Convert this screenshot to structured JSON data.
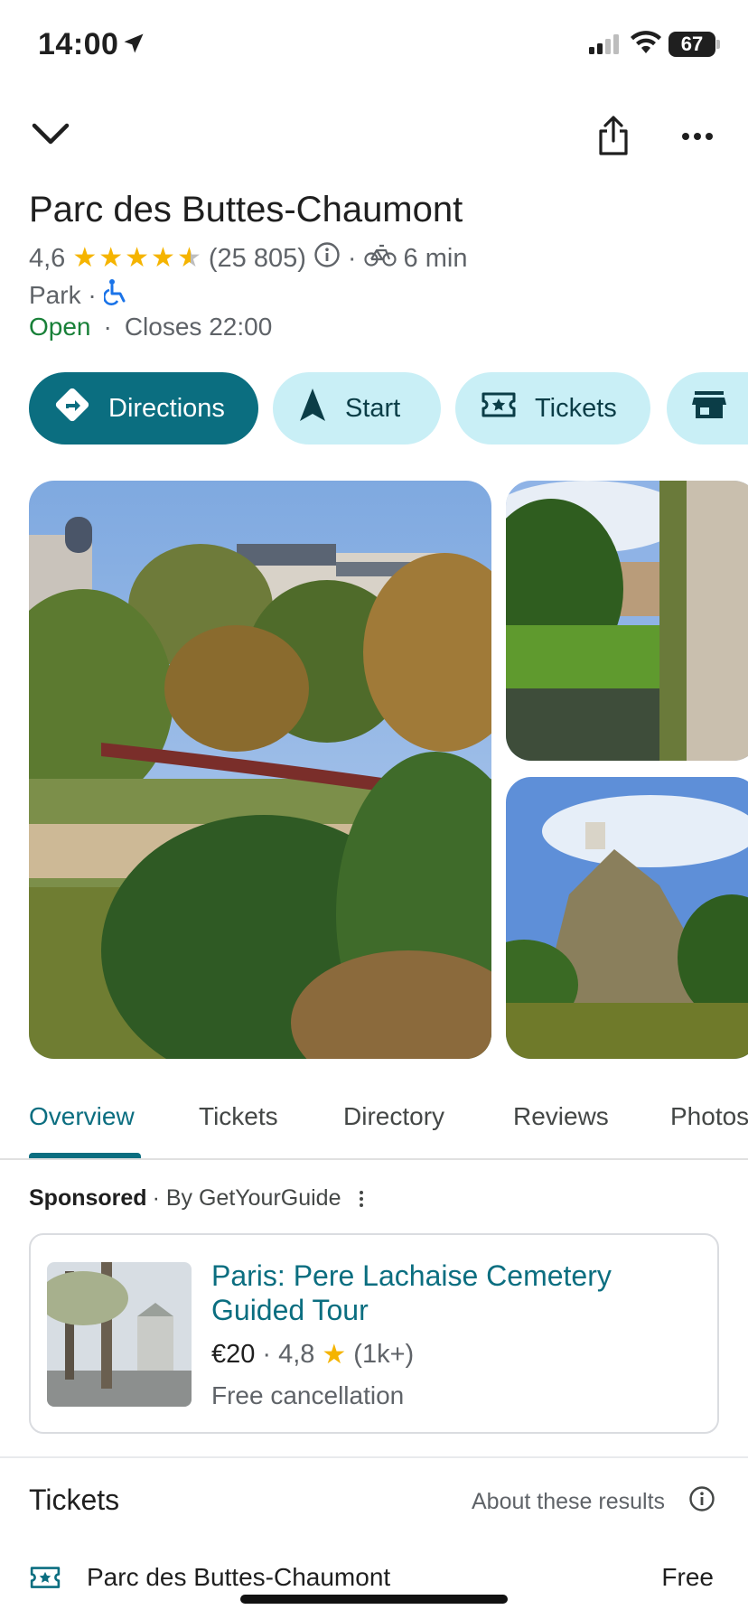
{
  "status_bar": {
    "time": "14:00",
    "battery": "67"
  },
  "place": {
    "name": "Parc des Buttes-Chaumont",
    "rating": "4,6",
    "stars": 4.5,
    "review_count": "(25 805)",
    "separator": "·",
    "travel_time": "6 min",
    "type": "Park ·",
    "open_status": "Open",
    "closes": "Closes 22:00"
  },
  "actions": {
    "directions": "Directions",
    "start": "Start",
    "tickets": "Tickets"
  },
  "tabs": {
    "overview": "Overview",
    "tickets": "Tickets",
    "directory": "Directory",
    "reviews": "Reviews",
    "photos": "Photos"
  },
  "sponsored": {
    "label": "Sponsored",
    "by": "· By GetYourGuide",
    "title": "Paris: Pere Lachaise Cemetery Guided Tour",
    "price": "€20",
    "dot": "·",
    "rating": "4,8",
    "count": "(1k+)",
    "cancellation": "Free cancellation"
  },
  "tickets_section": {
    "heading": "Tickets",
    "about": "About these results",
    "rows": [
      {
        "name": "Parc des Buttes-Chaumont",
        "price": "Free"
      }
    ]
  },
  "colors": {
    "accent": "#0b6e80",
    "chip_bg": "#c9eff6",
    "open": "#188038",
    "star": "#f5b400"
  }
}
